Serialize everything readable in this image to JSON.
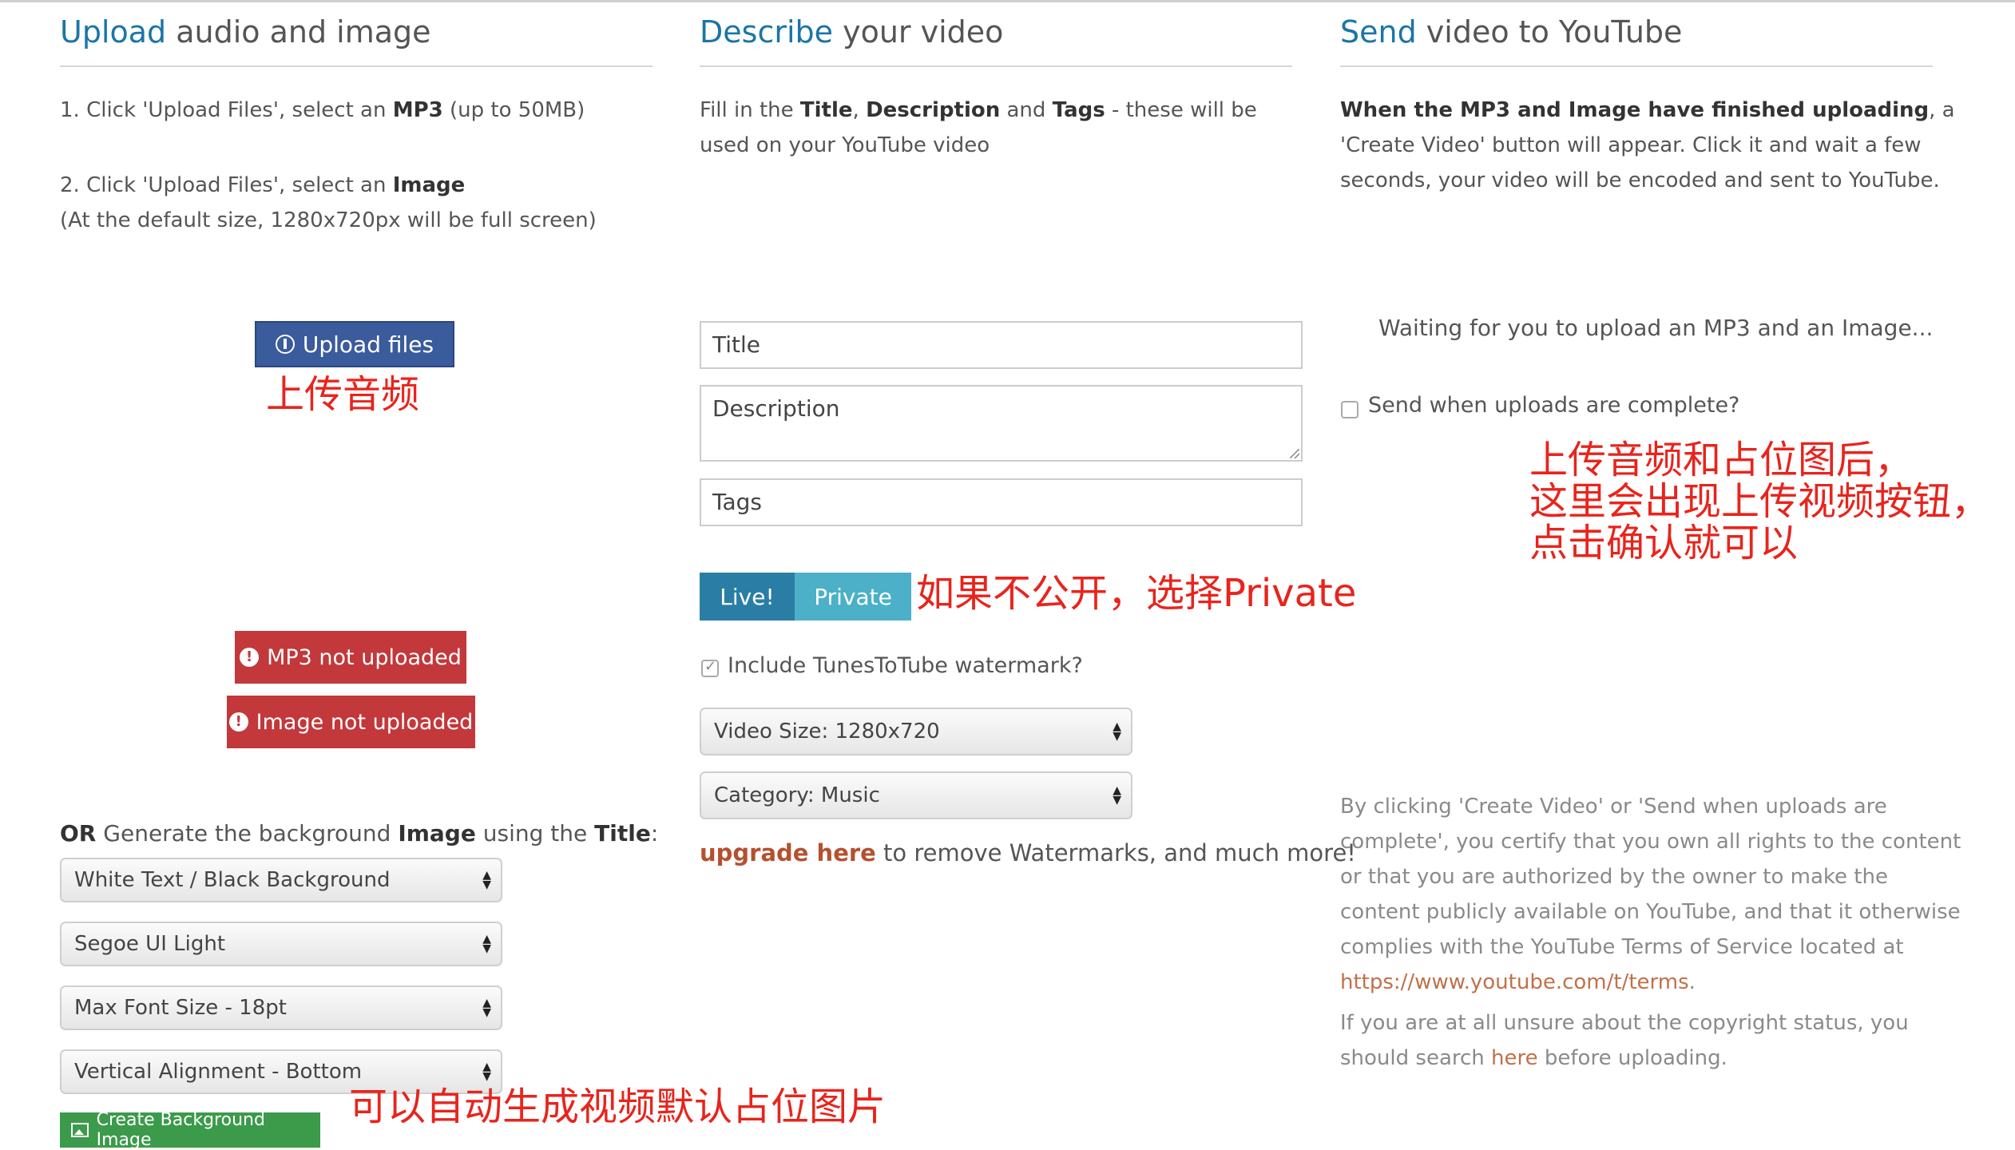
{
  "col1": {
    "heading_hl": "Upload",
    "heading_rest": " audio and image",
    "step1_pre": "1. Click 'Upload Files', select an ",
    "step1_bold": "MP3",
    "step1_post": " (up to 50MB)",
    "step2_pre": "2. Click 'Upload Files', select an ",
    "step2_bold": "Image",
    "step2_note": "(At the default size, 1280x720px will be full screen)",
    "upload_button": "Upload files",
    "annotation_upload": "上传音频",
    "mp3_status": "MP3 not uploaded",
    "image_status": "Image not uploaded",
    "generate_or": "OR",
    "generate_mid": " Generate the background ",
    "generate_image": "Image",
    "generate_using": " using the ",
    "generate_title": "Title",
    "generate_colon": ":",
    "selects": {
      "text_color": "White Text / Black Background",
      "font": "Segoe UI Light",
      "font_size": "Max Font Size - 18pt",
      "alignment": "Vertical Alignment - Bottom"
    },
    "create_bg_button": "Create Background Image",
    "annotation_bg": "可以自动生成视频默认占位图片"
  },
  "col2": {
    "heading_hl": "Describe",
    "heading_rest": " your video",
    "intro_pre": "Fill in the ",
    "intro_title": "Title",
    "intro_comma": ", ",
    "intro_desc": "Description",
    "intro_and": " and ",
    "intro_tags": "Tags",
    "intro_post": " - these will be used on your YouTube video",
    "title_placeholder": "Title",
    "description_placeholder": "Description",
    "tags_placeholder": "Tags",
    "toggle_live": "Live!",
    "toggle_private": "Private",
    "annotation_private": "如果不公开，选择Private",
    "watermark_label": "Include TunesToTube watermark?",
    "watermark_checked": true,
    "video_size": "Video Size: 1280x720",
    "category": "Category: Music",
    "upgrade_link": "upgrade here",
    "upgrade_rest": " to remove Watermarks, and much more!"
  },
  "col3": {
    "heading_hl": "Send",
    "heading_rest": " video to YouTube",
    "intro_bold": "When the MP3 and Image have finished uploading",
    "intro_rest": ", a 'Create Video' button will appear. Click it and wait a few seconds, your video will be encoded and sent to YouTube.",
    "waiting": "Waiting for you to upload an MP3 and an Image...",
    "send_when_complete": "Send when uploads are complete?",
    "send_checked": false,
    "annotation_lines": [
      "上传音频和占位图后，",
      "这里会出现上传视频按钮，",
      "点击确认就可以"
    ],
    "legal_text": "By clicking 'Create Video' or 'Send when uploads are complete', you certify that you own all rights to the content or that you are authorized by the owner to make the content publicly available on YouTube, and that it otherwise complies with the YouTube Terms of Service located at ",
    "legal_link": "https://www.youtube.com/t/terms",
    "legal_end": ".",
    "unsure_pre": "If you are at all unsure about the copyright status, you should search ",
    "unsure_link": "here",
    "unsure_post": " before uploading."
  },
  "colors": {
    "heading_accent": "#1a75a8",
    "upload_button": "#3a5b9c",
    "status_red": "#c2383b",
    "toggle_live": "#2a7ea5",
    "toggle_private": "#4bb0c8",
    "create_bg_green": "#3c9a4b",
    "annotation_red": "#e8241c",
    "link": "#b5502f"
  },
  "icons": {
    "upload": "upload-circle-icon",
    "status": "exclamation-circle-icon",
    "create_bg": "image-icon",
    "select_arrows": "updown-arrows-icon"
  }
}
